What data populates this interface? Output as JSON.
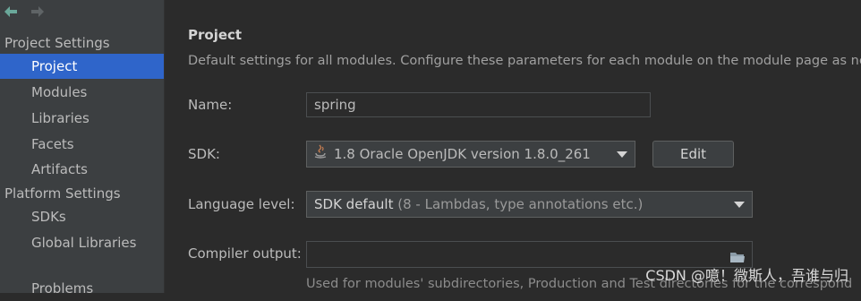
{
  "sidebar": {
    "groups": [
      {
        "label": "Project Settings",
        "items": [
          "Project",
          "Modules",
          "Libraries",
          "Facets",
          "Artifacts"
        ]
      },
      {
        "label": "Platform Settings",
        "items": [
          "SDKs",
          "Global Libraries"
        ]
      }
    ],
    "problems_label": "Problems",
    "selected": "Project"
  },
  "main": {
    "title": "Project",
    "description": "Default settings for all modules. Configure these parameters for each module on the module page as ne",
    "name_label": "Name:",
    "name_value": "spring",
    "sdk_label": "SDK:",
    "sdk_value": "1.8 Oracle OpenJDK version 1.8.0_261",
    "edit_label": "Edit",
    "language_label": "Language level:",
    "language_value": "SDK default",
    "language_hint": "(8 - Lambdas, type annotations etc.)",
    "compiler_label": "Compiler output:",
    "compiler_value": "",
    "compiler_hint": "Used for modules' subdirectories, Production and Test directories for the correspond"
  },
  "watermark": "CSDN @噫！微斯人，吾谁与归",
  "colors": {
    "accent": "#2f65ca",
    "background": "#2b2b2b",
    "sidebar": "#3c3f41"
  }
}
